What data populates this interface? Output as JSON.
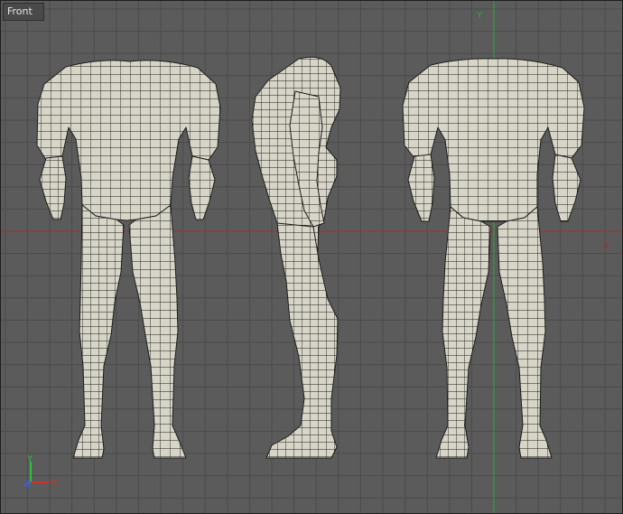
{
  "viewport": {
    "label": "Front",
    "background": "#5b5b5b",
    "grid_color": "#4b4b4b",
    "axes": {
      "x_label": "X",
      "y_label": "Y",
      "x_color": "#b02a2a",
      "y_color": "#2da836"
    },
    "gizmo": {
      "x_label": "X",
      "y_label": "Y",
      "z_label": "Z",
      "x_color": "#d03030",
      "y_color": "#30c040",
      "z_color": "#4060e0"
    },
    "mesh": {
      "fill": "#d7d5c8",
      "wire": "#1c1c18",
      "views": [
        "front-view",
        "side-view",
        "back-view"
      ]
    }
  }
}
